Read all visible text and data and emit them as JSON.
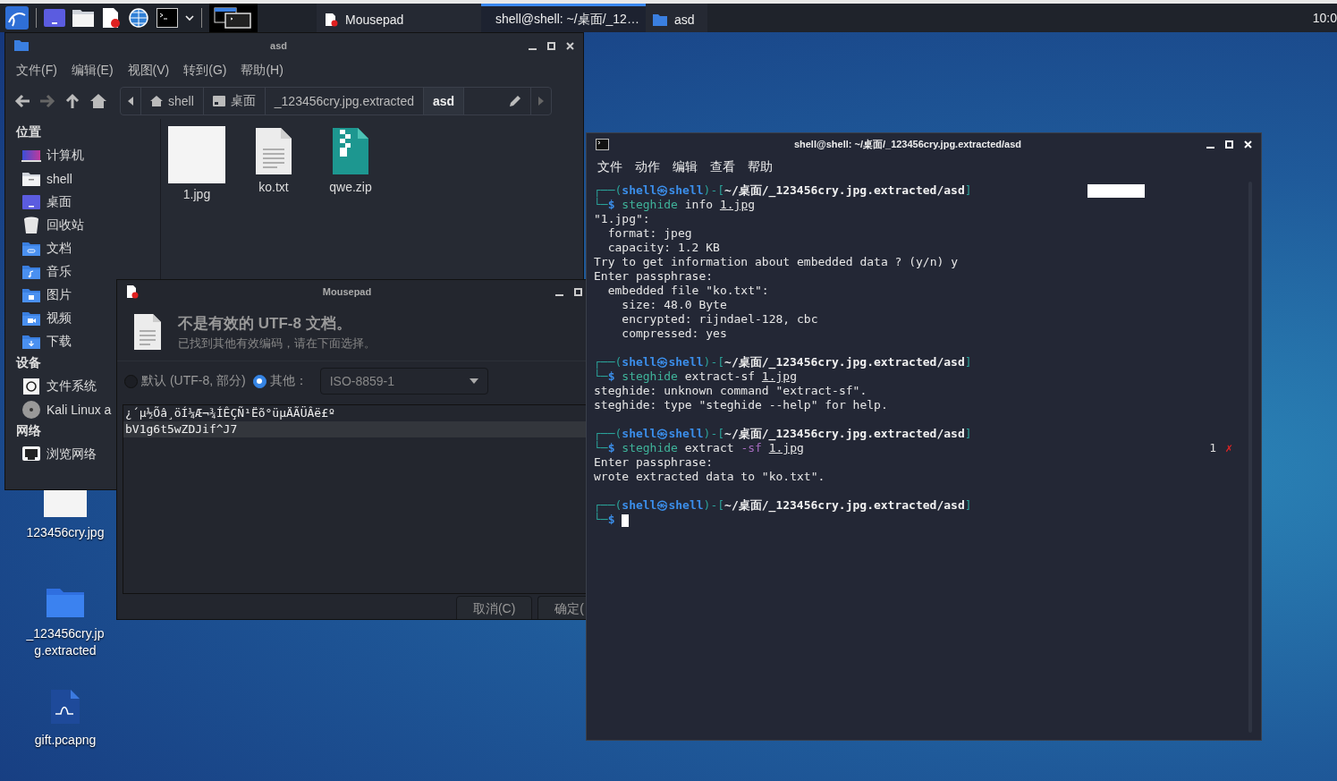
{
  "taskbar": {
    "tasks": [
      {
        "title": "Mousepad",
        "kind": "editor",
        "selected": false
      },
      {
        "title": "shell@shell: ~/桌面/_12…",
        "kind": "terminal",
        "selected": true
      },
      {
        "title": "asd",
        "kind": "folder",
        "selected": false
      }
    ],
    "clock": "10:0"
  },
  "file_manager": {
    "title": "asd",
    "menu": [
      "文件(F)",
      "编辑(E)",
      "视图(V)",
      "转到(G)",
      "帮助(H)"
    ],
    "path": [
      {
        "label": "shell",
        "kind": "home",
        "selected": false
      },
      {
        "label": "桌面",
        "kind": "desktop",
        "selected": false
      },
      {
        "label": "_123456cry.jpg.extracted",
        "kind": "plain",
        "selected": false
      },
      {
        "label": "asd",
        "kind": "plain",
        "selected": true
      }
    ],
    "sidebar": [
      {
        "heading": "位置",
        "items": [
          {
            "label": "计算机",
            "kind": "computer"
          },
          {
            "label": "shell",
            "kind": "home"
          },
          {
            "label": "桌面",
            "kind": "desktop"
          },
          {
            "label": "回收站",
            "kind": "trash"
          },
          {
            "label": "文档",
            "kind": "documents"
          },
          {
            "label": "音乐",
            "kind": "music"
          },
          {
            "label": "图片",
            "kind": "pictures"
          },
          {
            "label": "视频",
            "kind": "videos"
          },
          {
            "label": "下载",
            "kind": "downloads"
          }
        ]
      },
      {
        "heading": "设备",
        "items": [
          {
            "label": "文件系统",
            "kind": "filesystem"
          },
          {
            "label": "Kali Linux a",
            "kind": "disc"
          }
        ]
      },
      {
        "heading": "网络",
        "items": [
          {
            "label": "浏览网络",
            "kind": "network"
          }
        ]
      }
    ],
    "files": [
      {
        "name": "1.jpg",
        "kind": "image"
      },
      {
        "name": "ko.txt",
        "kind": "text"
      },
      {
        "name": "qwe.zip",
        "kind": "archive"
      }
    ]
  },
  "mousepad": {
    "title": "Mousepad",
    "heading": "不是有效的 UTF-8 文档。",
    "message": "已找到其他有效编码，请在下面选择。",
    "options": [
      {
        "label": "默认 (UTF-8, 部分)",
        "selected": false
      },
      {
        "label": "其他：",
        "selected": true
      }
    ],
    "encoding": "ISO-8859-1",
    "preview": [
      {
        "text": "¿´µ½Õâ¸öÍ¼Æ¬¾ÍÊÇÑ¹Ëõ°üµÄÃÜÂë£º",
        "current": false
      },
      {
        "text": "bV1g6t5wZDJif^J7",
        "current": true
      }
    ],
    "buttons": [
      "取消(C)",
      "确定("
    ]
  },
  "terminal": {
    "title": "shell@shell: ~/桌面/_123456cry.jpg.extracted/asd",
    "menu": [
      "文件",
      "动作",
      "编辑",
      "查看",
      "帮助"
    ],
    "lines": [
      {
        "kind": "prompt",
        "segments": [
          {
            "text": "┌──(",
            "kind": "frame"
          },
          {
            "text": "shell㉿shell",
            "kind": "user"
          },
          {
            "text": ")-[",
            "kind": "frame"
          },
          {
            "text": "~/桌面/_123456cry.jpg.extracted/asd",
            "kind": "path"
          },
          {
            "text": "]",
            "kind": "frame"
          }
        ]
      },
      {
        "kind": "command",
        "cursor": false,
        "segments": [
          {
            "text": "└─",
            "kind": "frame"
          },
          {
            "text": "$ ",
            "kind": "dollar"
          },
          {
            "text": "steghide ",
            "kind": "program"
          },
          {
            "text": "info ",
            "kind": "arg"
          },
          {
            "text": "1.jpg",
            "kind": "file"
          }
        ]
      },
      {
        "kind": "output",
        "text": "\"1.jpg\":"
      },
      {
        "kind": "output",
        "text": "  format: jpeg"
      },
      {
        "kind": "output",
        "text": "  capacity: 1.2 KB"
      },
      {
        "kind": "output",
        "text": "Try to get information about embedded data ? (y/n) y"
      },
      {
        "kind": "output",
        "text": "Enter passphrase:"
      },
      {
        "kind": "output",
        "text": "  embedded file \"ko.txt\":"
      },
      {
        "kind": "output",
        "text": "    size: 48.0 Byte"
      },
      {
        "kind": "output",
        "text": "    encrypted: rijndael-128, cbc"
      },
      {
        "kind": "output",
        "text": "    compressed: yes"
      },
      {
        "kind": "prompt",
        "segments": [
          {
            "text": "┌──(",
            "kind": "frame"
          },
          {
            "text": "shell㉿shell",
            "kind": "user"
          },
          {
            "text": ")-[",
            "kind": "frame"
          },
          {
            "text": "~/桌面/_123456cry.jpg.extracted/asd",
            "kind": "path"
          },
          {
            "text": "]",
            "kind": "frame"
          }
        ]
      },
      {
        "kind": "command",
        "cursor": false,
        "segments": [
          {
            "text": "└─",
            "kind": "frame"
          },
          {
            "text": "$ ",
            "kind": "dollar"
          },
          {
            "text": "steghide ",
            "kind": "program"
          },
          {
            "text": "extract-sf ",
            "kind": "arg"
          },
          {
            "text": "1.jpg",
            "kind": "file"
          }
        ]
      },
      {
        "kind": "output",
        "text": "steghide: unknown command \"extract-sf\"."
      },
      {
        "kind": "output",
        "text": "steghide: type \"steghide --help\" for help."
      },
      {
        "kind": "prompt",
        "segments": [
          {
            "text": "┌──(",
            "kind": "frame"
          },
          {
            "text": "shell㉿shell",
            "kind": "user"
          },
          {
            "text": ")-[",
            "kind": "frame"
          },
          {
            "text": "~/桌面/_123456cry.jpg.extracted/asd",
            "kind": "path"
          },
          {
            "text": "]",
            "kind": "frame"
          }
        ]
      },
      {
        "kind": "command",
        "cursor": false,
        "status": "1",
        "status_mark": "✗",
        "segments": [
          {
            "text": "└─",
            "kind": "frame"
          },
          {
            "text": "$ ",
            "kind": "dollar"
          },
          {
            "text": "steghide ",
            "kind": "program"
          },
          {
            "text": "extract ",
            "kind": "arg"
          },
          {
            "text": "-sf ",
            "kind": "flag"
          },
          {
            "text": "1.jpg",
            "kind": "file"
          }
        ]
      },
      {
        "kind": "output",
        "text": "Enter passphrase:"
      },
      {
        "kind": "output",
        "text": "wrote extracted data to \"ko.txt\"."
      },
      {
        "kind": "prompt",
        "segments": [
          {
            "text": "┌──(",
            "kind": "frame"
          },
          {
            "text": "shell㉿shell",
            "kind": "user"
          },
          {
            "text": ")-[",
            "kind": "frame"
          },
          {
            "text": "~/桌面/_123456cry.jpg.extracted/asd",
            "kind": "path"
          },
          {
            "text": "]",
            "kind": "frame"
          }
        ]
      },
      {
        "kind": "command",
        "cursor": true,
        "segments": [
          {
            "text": "└─",
            "kind": "frame"
          },
          {
            "text": "$ ",
            "kind": "dollar"
          }
        ]
      }
    ]
  },
  "desktop_icons": [
    {
      "name": "123456cry.jpg",
      "kind": "image"
    },
    {
      "name": "_123456cry.jpg.extracted",
      "kind": "folder"
    },
    {
      "name": "gift.pcapng",
      "kind": "capture"
    }
  ]
}
